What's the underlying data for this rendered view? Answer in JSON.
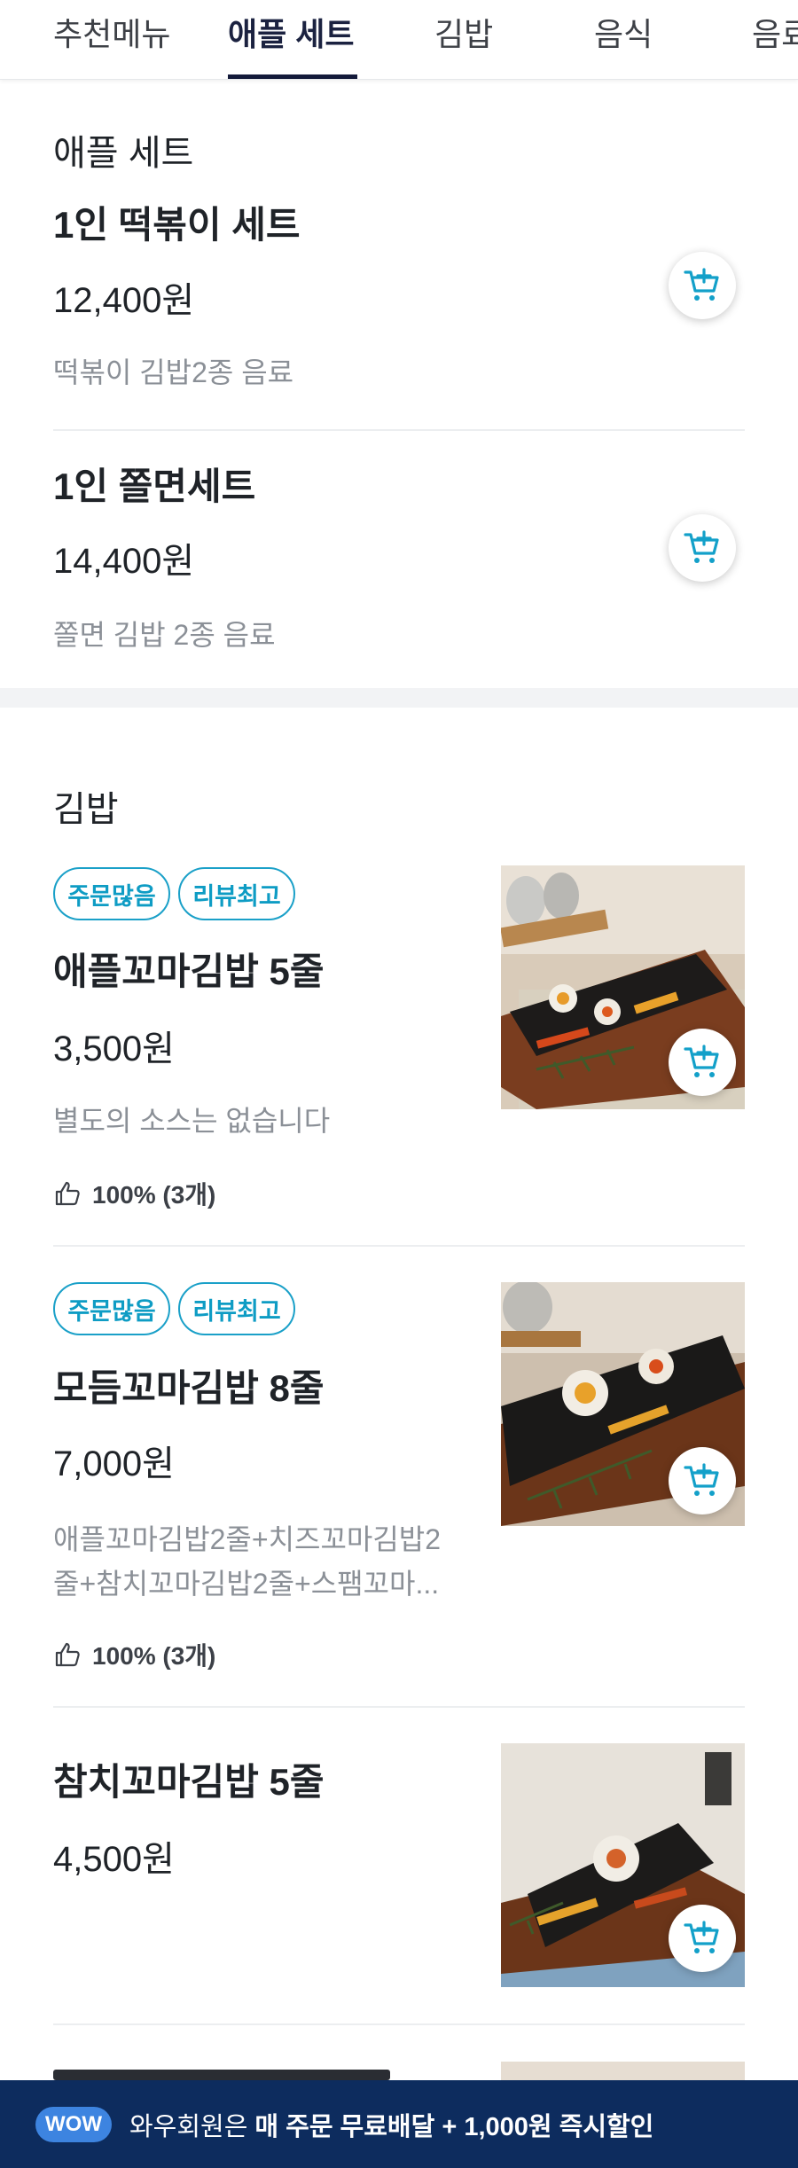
{
  "tabs": [
    {
      "label": "추천메뉴"
    },
    {
      "label": "애플 세트"
    },
    {
      "label": "김밥"
    },
    {
      "label": "음식"
    },
    {
      "label": "음료"
    }
  ],
  "active_tab": "애플 세트",
  "apple_set": {
    "title": "애플 세트",
    "items": [
      {
        "name": "1인 떡볶이 세트",
        "price": "12,400원",
        "desc": "떡볶이 김밥2종 음료"
      },
      {
        "name": "1인 쫄면세트",
        "price": "14,400원",
        "desc": "쫄면 김밥 2종 음료"
      }
    ]
  },
  "gimbap": {
    "title": "김밥",
    "items": [
      {
        "badges": [
          "주문많음",
          "리뷰최고"
        ],
        "name": "애플꼬마김밥 5줄",
        "price": "3,500원",
        "desc": "별도의 소스는 없습니다",
        "rating": "100% (3개)"
      },
      {
        "badges": [
          "주문많음",
          "리뷰최고"
        ],
        "name": "모듬꼬마김밥 8줄",
        "price": "7,000원",
        "desc_line1": "애플꼬마김밥2줄+치즈꼬마김밥2",
        "desc_line2": "줄+참치꼬마김밥2줄+스팸꼬마...",
        "rating": "100% (3개)"
      },
      {
        "name": "참치꼬마김밥 5줄",
        "price": "4,500원"
      }
    ]
  },
  "banner": {
    "pill": "WOW",
    "text": "와우회원은",
    "strong": "매 주문 무료배달 + 1,000원 즉시할인"
  },
  "colors": {
    "accent": "#1aa0c8",
    "banner_bg": "#0d2c5e",
    "tab_underline": "#131a3a"
  },
  "icons": [
    "cart-add-icon",
    "thumbs-up-icon"
  ]
}
